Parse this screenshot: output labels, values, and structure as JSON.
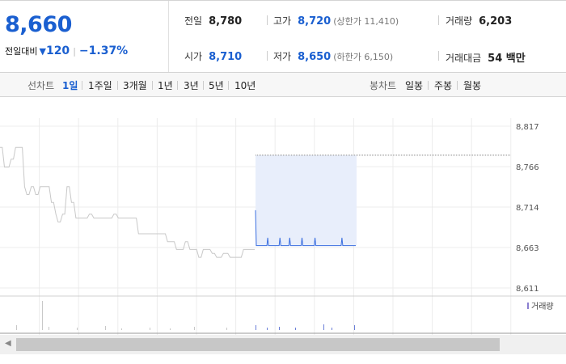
{
  "summary": {
    "price": "8,660",
    "change_label": "전일대비",
    "change_value": "120",
    "change_pct": "−1.37%"
  },
  "info": {
    "prev_label": "전일",
    "prev_value": "8,780",
    "high_label": "고가",
    "high_value": "8,720",
    "high_sub": "(상한가 11,410)",
    "vol_label": "거래량",
    "vol_value": "6,203",
    "open_label": "시가",
    "open_value": "8,710",
    "low_label": "저가",
    "low_value": "8,650",
    "low_sub": "(하한가 6,150)",
    "amt_label": "거래대금",
    "amt_value": "54 백만"
  },
  "tabs": {
    "line_label": "선차트",
    "line_tabs": [
      "1일",
      "1주일",
      "3개월",
      "1년",
      "3년",
      "5년",
      "10년"
    ],
    "candle_label": "봉차트",
    "candle_tabs": [
      "일봉",
      "주봉",
      "월봉"
    ]
  },
  "colors": {
    "accent": "#1a5fd0",
    "prev_line": "#c8c8c8",
    "today_line": "#3b6fe0",
    "highlight": "#e8eefb"
  },
  "chart_data": {
    "type": "line",
    "yticks": [
      "8,817",
      "8,766",
      "8,714",
      "8,663",
      "8,611"
    ],
    "ylim": [
      8611,
      8817
    ],
    "volume_label": "거래량",
    "series": [
      {
        "values": [
          8790,
          8790,
          8765,
          8765,
          8765,
          8775,
          8775,
          8790,
          8790,
          8790,
          8790,
          8740,
          8730,
          8730,
          8740,
          8740,
          8730,
          8730,
          8740,
          8740,
          8740,
          8740,
          8740,
          8720,
          8720,
          8705,
          8695,
          8695,
          8705,
          8705,
          8740,
          8740,
          8720,
          8720,
          8700,
          8700,
          8700,
          8700,
          8700,
          8700,
          8705,
          8705,
          8700,
          8700,
          8700,
          8700,
          8700,
          8700,
          8700,
          8700,
          8700,
          8705,
          8705,
          8700,
          8700,
          8700,
          8700,
          8700,
          8700,
          8700,
          8700,
          8700,
          8680,
          8680,
          8680,
          8680,
          8680,
          8680,
          8680,
          8680,
          8680,
          8680,
          8680,
          8680,
          8680,
          8670,
          8670,
          8670,
          8670,
          8660,
          8660,
          8660,
          8660,
          8670,
          8670,
          8660,
          8660,
          8660,
          8660,
          8650,
          8650,
          8660,
          8660,
          8660,
          8660,
          8655,
          8655,
          8650,
          8650,
          8650,
          8655,
          8655,
          8655,
          8650,
          8650,
          8650,
          8650,
          8650,
          8650,
          8660,
          8660,
          8660,
          8660,
          8660,
          8660
        ]
      },
      {
        "values": [
          8710,
          8665,
          8665,
          8665,
          8665,
          8665,
          8665,
          8665,
          8665,
          8665,
          8665,
          8665,
          8665,
          8665,
          8665,
          8675,
          8665,
          8665,
          8665,
          8665,
          8665,
          8665,
          8665,
          8665,
          8665,
          8665,
          8665,
          8665,
          8665,
          8665,
          8675,
          8665,
          8665,
          8665,
          8665,
          8665,
          8665,
          8665,
          8665,
          8665,
          8665,
          8665,
          8675,
          8665,
          8665,
          8665,
          8665,
          8665,
          8665,
          8665,
          8665,
          8665,
          8665,
          8665,
          8665,
          8665,
          8665,
          8675,
          8665,
          8665,
          8665,
          8665,
          8665,
          8665,
          8665,
          8665,
          8665,
          8665,
          8665,
          8665,
          8665,
          8665,
          8665,
          8675,
          8665,
          8665,
          8665,
          8665,
          8665,
          8665,
          8665,
          8665,
          8665,
          8665,
          8665,
          8665,
          8665,
          8665,
          8665,
          8665,
          8665,
          8665,
          8665,
          8665,
          8665,
          8665,
          8665,
          8665,
          8665,
          8665,
          8665,
          8665,
          8665,
          8665,
          8665,
          8665,
          8675,
          8665,
          8665,
          8665,
          8665,
          8665,
          8665,
          8665,
          8665,
          8665,
          8665,
          8665,
          8665,
          8665,
          8665,
          8665,
          8665,
          8665
        ]
      }
    ],
    "prev_close": 8780,
    "grid": true
  }
}
